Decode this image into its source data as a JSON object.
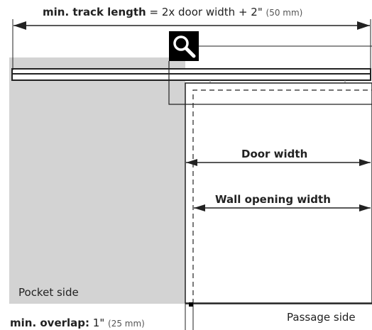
{
  "title": {
    "bold_part": "min. track length",
    "formula": " = 2x door width + 2\"",
    "metric": "(50 mm)"
  },
  "labels": {
    "door_width": "Door width",
    "wall_opening_width": "Wall opening width",
    "pocket_side": "Pocket side",
    "passage_side": "Passage side"
  },
  "overlap": {
    "bold_part": "min. overlap:",
    "value": " 1\"",
    "metric": "(25 mm)"
  },
  "icons": {
    "zoom": "magnifier-icon"
  },
  "colors": {
    "pocket_wall": "#d3d3d3",
    "lines": "#222222",
    "zoom_bg": "#000000"
  }
}
